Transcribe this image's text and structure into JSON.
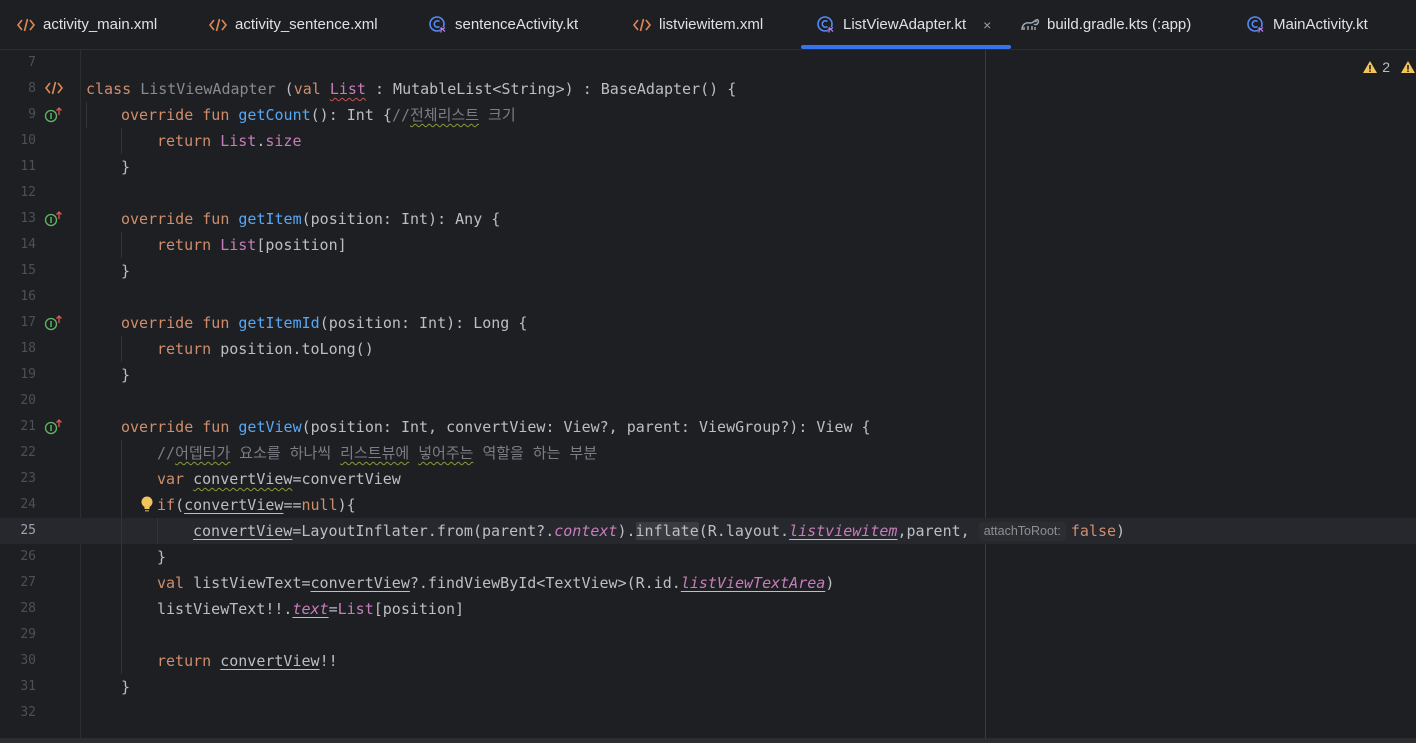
{
  "tabs": [
    {
      "label": "activity_main.xml",
      "icon": "xml-icon"
    },
    {
      "label": "activity_sentence.xml",
      "icon": "xml-icon"
    },
    {
      "label": "sentenceActivity.kt",
      "icon": "kotlin-class-icon"
    },
    {
      "label": "listviewitem.xml",
      "icon": "xml-icon"
    },
    {
      "label": "ListViewAdapter.kt",
      "icon": "kotlin-class-icon",
      "active": true,
      "close": "×"
    },
    {
      "label": "build.gradle.kts (:app)",
      "icon": "gradle-icon"
    },
    {
      "label": "MainActivity.kt",
      "icon": "kotlin-class-icon"
    }
  ],
  "inspections": {
    "warnings": "2"
  },
  "editor": {
    "current_line": "25",
    "colors": {
      "keyword": "#cf8e6d",
      "function": "#56a8f5",
      "property": "#c77dbb",
      "comment": "#7a7e85",
      "active_tab": "#3574f0"
    },
    "lines": {
      "l7": {
        "num": "7"
      },
      "l8": {
        "num": "8",
        "t1": "class ",
        "t2": "ListViewAdapter",
        "t3": " (",
        "t4": "val ",
        "t5": "List",
        "t6": " : MutableList<String>) : BaseAdapter() {"
      },
      "l9": {
        "num": "9",
        "t1": "override fun ",
        "t2": "getCount",
        "t3": "(): Int {",
        "t4": "//",
        "t5": "전체리스트",
        "t6": " 크기"
      },
      "l10": {
        "num": "10",
        "t1": "return ",
        "t2": "List",
        "t3": ".",
        "t4": "size"
      },
      "l11": {
        "num": "11",
        "t1": "}"
      },
      "l12": {
        "num": "12"
      },
      "l13": {
        "num": "13",
        "t1": "override fun ",
        "t2": "getItem",
        "t3": "(position: Int): Any {"
      },
      "l14": {
        "num": "14",
        "t1": "return ",
        "t2": "List",
        "t3": "[position]"
      },
      "l15": {
        "num": "15",
        "t1": "}"
      },
      "l16": {
        "num": "16"
      },
      "l17": {
        "num": "17",
        "t1": "override fun ",
        "t2": "getItemId",
        "t3": "(position: Int): Long {"
      },
      "l18": {
        "num": "18",
        "t1": "return ",
        "t2": "position.toLong()"
      },
      "l19": {
        "num": "19",
        "t1": "}"
      },
      "l20": {
        "num": "20"
      },
      "l21": {
        "num": "21",
        "t1": "override fun ",
        "t2": "getView",
        "t3": "(position: Int, convertView: View?, parent: ViewGroup?): View {"
      },
      "l22": {
        "num": "22",
        "t1": "//",
        "t2": "어뎁터가",
        "t3": " 요소를 하나씩 ",
        "t4": "리스트뷰에",
        "t5": " ",
        "t6": "넣어주는",
        "t7": " 역할을 하는 부분"
      },
      "l23": {
        "num": "23",
        "t1": "var ",
        "t2": "convertView",
        "t3": "=convertView"
      },
      "l24": {
        "num": "24",
        "t1": "if",
        "t2": "(",
        "t3": "convertView",
        "t4": "==",
        "t5": "null",
        "t6": "){"
      },
      "l25": {
        "num": "25",
        "t1": "convertView",
        "t2": "=LayoutInflater.from(parent?.",
        "t3": "context",
        "t4": ").",
        "t5": "inflate",
        "t6": "(R.layout.",
        "t7": "listviewitem",
        "t8": ",parent, ",
        "hint": "attachToRoot:",
        "t9": "false",
        "t10": ")"
      },
      "l26": {
        "num": "26",
        "t1": "}"
      },
      "l27": {
        "num": "27",
        "t1": "val ",
        "t2": "listViewText=",
        "t3": "convertView",
        "t4": "?.findViewById<TextView>(R.id.",
        "t5": "listViewTextArea",
        "t6": ")"
      },
      "l28": {
        "num": "28",
        "t1": "listViewText!!.",
        "t2": "text",
        "t3": "=",
        "t4": "List",
        "t5": "[position]"
      },
      "l29": {
        "num": "29"
      },
      "l30": {
        "num": "30",
        "t1": "return ",
        "t2": "convertView",
        "t3": "!!"
      },
      "l31": {
        "num": "31",
        "t1": "}"
      },
      "l32": {
        "num": "32"
      }
    }
  }
}
